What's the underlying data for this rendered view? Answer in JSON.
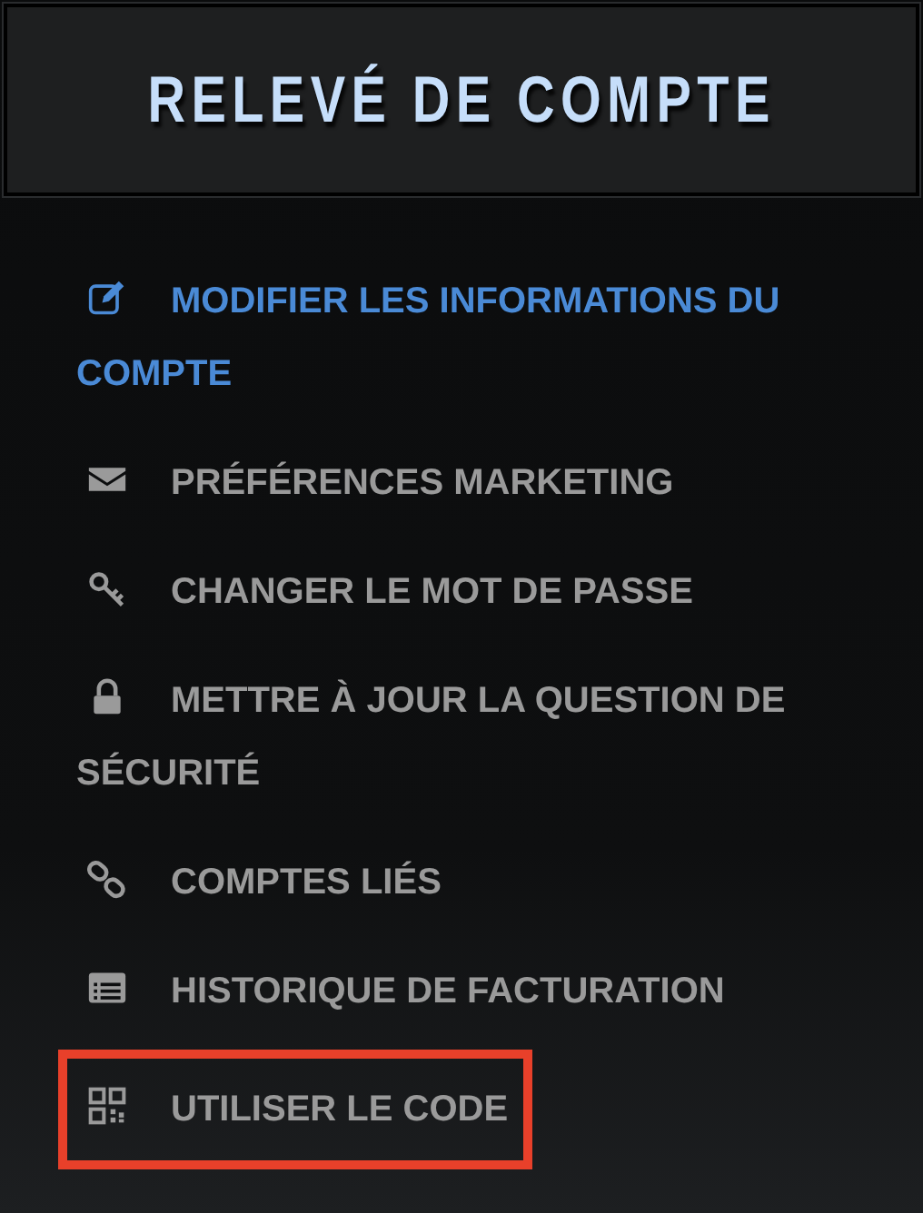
{
  "title": "RELEVÉ DE COMPTE",
  "menu": [
    {
      "label": "MODIFIER LES INFORMATIONS DU COMPTE",
      "selected": true,
      "highlighted": false
    },
    {
      "label": "PRÉFÉRENCES MARKETING",
      "selected": false,
      "highlighted": false
    },
    {
      "label": "CHANGER LE MOT DE PASSE",
      "selected": false,
      "highlighted": false
    },
    {
      "label": "METTRE À JOUR LA QUESTION DE SÉCURITÉ",
      "selected": false,
      "highlighted": false
    },
    {
      "label": "COMPTES LIÉS",
      "selected": false,
      "highlighted": false
    },
    {
      "label": "HISTORIQUE DE FACTURATION",
      "selected": false,
      "highlighted": false
    },
    {
      "label": "UTILISER LE CODE",
      "selected": false,
      "highlighted": true
    }
  ]
}
